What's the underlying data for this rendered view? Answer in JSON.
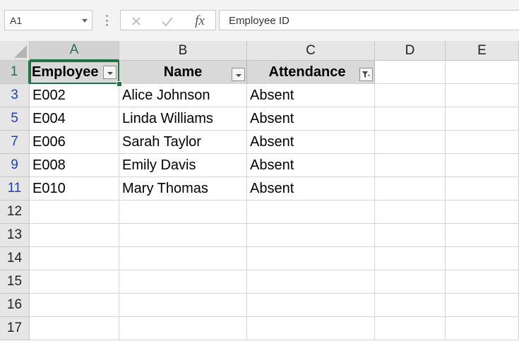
{
  "name_box": {
    "value": "A1"
  },
  "formula_bar": {
    "fx_label": "fx",
    "value": "Employee ID"
  },
  "columns": [
    "A",
    "B",
    "C",
    "D",
    "E"
  ],
  "rows": [
    {
      "label": "1"
    },
    {
      "label": "3"
    },
    {
      "label": "5"
    },
    {
      "label": "7"
    },
    {
      "label": "9"
    },
    {
      "label": "11"
    },
    {
      "label": "12"
    },
    {
      "label": "13"
    },
    {
      "label": "14"
    },
    {
      "label": "15"
    },
    {
      "label": "16"
    },
    {
      "label": "17"
    }
  ],
  "table": {
    "headers": [
      "Employee",
      "Name",
      "Attendance"
    ],
    "data": [
      [
        "E002",
        "Alice Johnson",
        "Absent"
      ],
      [
        "E004",
        "Linda Williams",
        "Absent"
      ],
      [
        "E006",
        "Sarah Taylor",
        "Absent"
      ],
      [
        "E008",
        "Emily Davis",
        "Absent"
      ],
      [
        "E010",
        "Mary Thomas",
        "Absent"
      ]
    ]
  },
  "colors": {
    "accent": "#217346",
    "filtered_row_label": "#1f3fbf"
  },
  "icons": {
    "cancel": "x-icon",
    "enter": "checkmark-icon",
    "function": "fx-icon",
    "dropdown": "filter-dropdown-icon",
    "filter_active": "filter-funnel-icon"
  }
}
